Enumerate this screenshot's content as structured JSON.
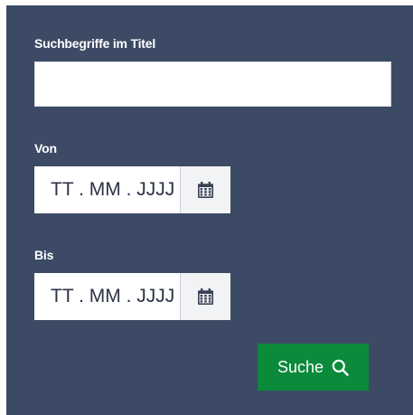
{
  "form": {
    "title_label": "Suchbegriffe im Titel",
    "title_value": "",
    "from_label": "Von",
    "from_placeholder": "TT . MM . JJJJ",
    "to_label": "Bis",
    "to_placeholder": "TT . MM . JJJJ",
    "search_label": "Suche"
  },
  "icons": {
    "calendar": "calendar-icon",
    "search": "search-icon"
  },
  "colors": {
    "panel_background": "#3c4a65",
    "search_button": "#0a8a3a",
    "calendar_button": "#f2f3f5",
    "icon": "#3a4258"
  }
}
